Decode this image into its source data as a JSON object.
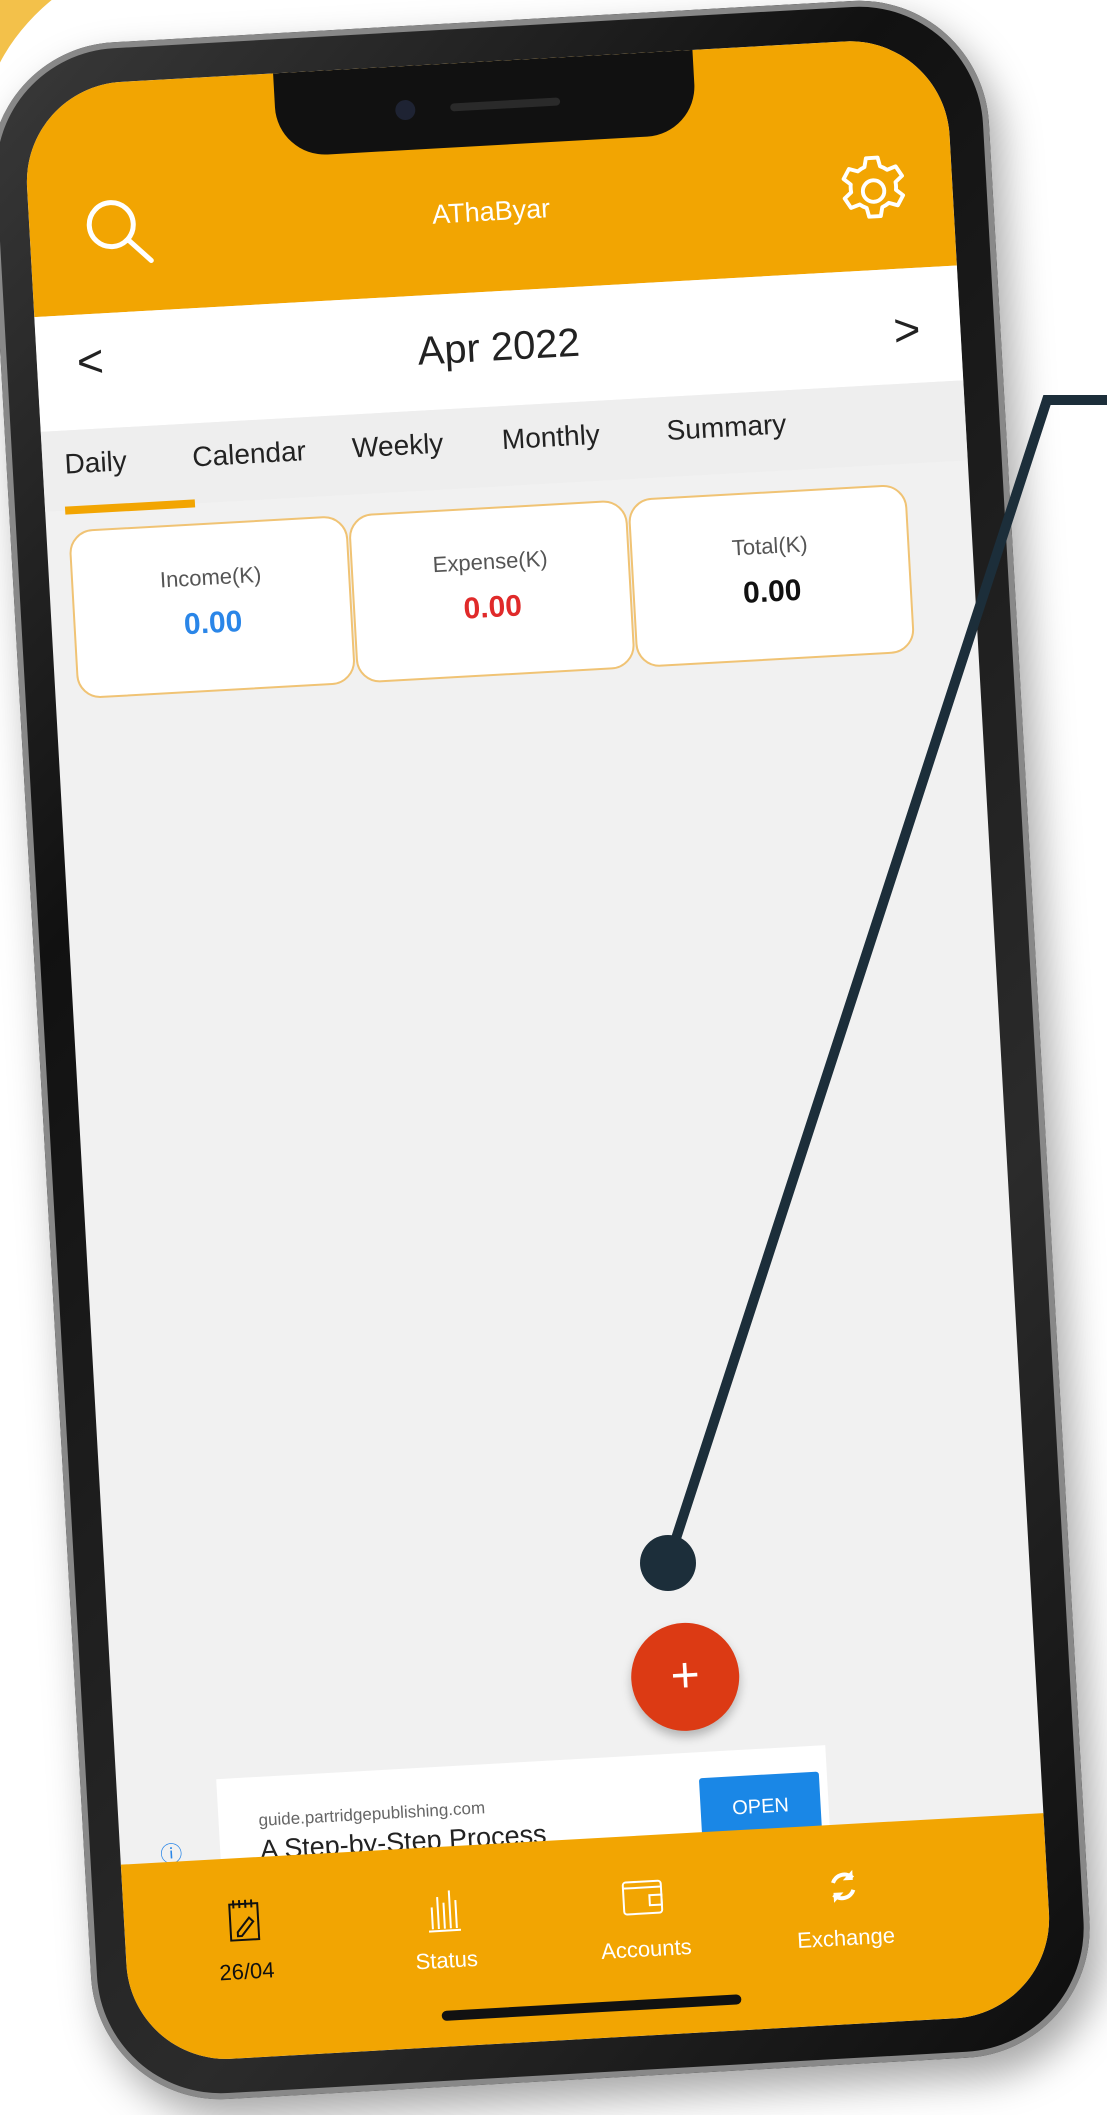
{
  "app": {
    "title": "AThaByar"
  },
  "month_nav": {
    "label": "Apr 2022",
    "prev": "<",
    "next": ">"
  },
  "tabs": [
    {
      "label": "Daily"
    },
    {
      "label": "Calendar"
    },
    {
      "label": "Weekly"
    },
    {
      "label": "Monthly"
    },
    {
      "label": "Summary"
    }
  ],
  "cards": {
    "income": {
      "label": "Income(K)",
      "value": "0.00",
      "color": "#2a86e8"
    },
    "expense": {
      "label": "Expense(K)",
      "value": "0.00",
      "color": "#e02a2a"
    },
    "total": {
      "label": "Total(K)",
      "value": "0.00",
      "color": "#111111"
    }
  },
  "fab": {
    "label": "+"
  },
  "ad": {
    "domain": "guide.partridgepublishing.com",
    "headline": "A Step-by-Step Process",
    "open_label": "OPEN",
    "info_glyph": "ⓘ",
    "close_glyph": "✕"
  },
  "bottom_nav": [
    {
      "label": "26/04",
      "icon": "notebook-pen-icon"
    },
    {
      "label": "Status",
      "icon": "bar-chart-icon"
    },
    {
      "label": "Accounts",
      "icon": "wallet-icon"
    },
    {
      "label": "Exchange",
      "icon": "refresh-icon"
    }
  ],
  "colors": {
    "brand": "#f2a502",
    "accent_blue": "#1a87e6",
    "fab_red": "#dc3a14"
  }
}
